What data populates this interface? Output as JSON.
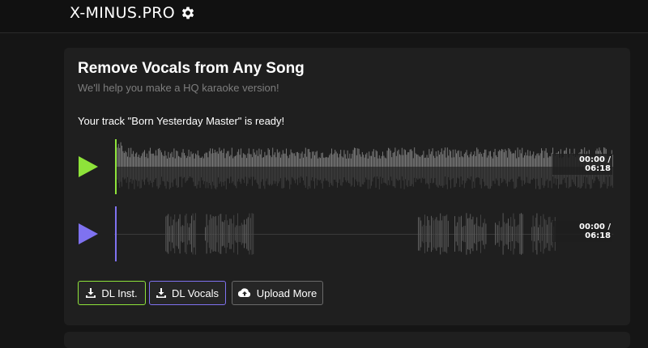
{
  "header": {
    "logo": "X-MINUS.PRO",
    "settings_icon": "gear-icon"
  },
  "card": {
    "title": "Remove Vocals from Any Song",
    "subtitle": "We'll help you make a HQ karaoke version!",
    "status": "Your track \"Born Yesterday Master\" is ready!"
  },
  "players": {
    "instrumental": {
      "time": "00:00 / 06:18",
      "color": "#8ee33a",
      "icon": "play-icon"
    },
    "vocals": {
      "time": "00:00 / 06:18",
      "color": "#7f72f0",
      "icon": "play-icon"
    }
  },
  "buttons": {
    "dl_inst": {
      "label": "DL Inst.",
      "icon": "download-icon"
    },
    "dl_vocals": {
      "label": "DL Vocals",
      "icon": "download-icon"
    },
    "upload_more": {
      "label": "Upload More",
      "icon": "cloud-upload-icon"
    }
  }
}
